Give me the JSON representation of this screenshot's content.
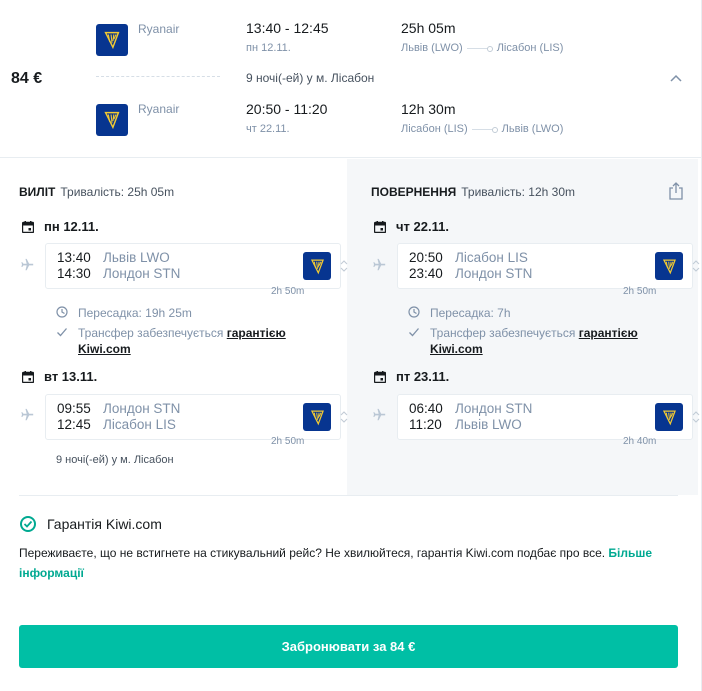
{
  "summary": {
    "price": "84 €",
    "outbound": {
      "carrier": "Ryanair",
      "times": "13:40 - 12:45",
      "date": "пн 12.11.",
      "duration": "25h 05m",
      "from": "Львів (LWO)",
      "to": "Лісабон (LIS)"
    },
    "stay": "9 ночі(-ей) у м. Лісабон",
    "inbound": {
      "carrier": "Ryanair",
      "times": "20:50 - 11:20",
      "date": "чт 22.11.",
      "duration": "12h 30m",
      "from": "Лісабон (LIS)",
      "to": "Львів (LWO)"
    }
  },
  "outbound_detail": {
    "label": "ВИЛІТ",
    "duration": "Тривалість: 25h 05m",
    "day1": "пн 12.11.",
    "seg1": {
      "dep_time": "13:40",
      "dep_place": "Львів LWO",
      "arr_time": "14:30",
      "arr_place": "Лондон STN",
      "duration": "2h 50m"
    },
    "layover": "Пересадка: 19h 25m",
    "transfer_text": "Трансфер забезпечується ",
    "transfer_link1": "гарантією",
    "transfer_link2": "Kiwi.com",
    "day2": "вт 13.11.",
    "seg2": {
      "dep_time": "09:55",
      "dep_place": "Лондон STN",
      "arr_time": "12:45",
      "arr_place": "Лісабон LIS",
      "duration": "2h 50m"
    },
    "nights": "9 ночі(-ей) у м. Лісабон"
  },
  "return_detail": {
    "label": "ПОВЕРНЕННЯ",
    "duration": "Тривалість: 12h 30m",
    "day1": "чт 22.11.",
    "seg1": {
      "dep_time": "20:50",
      "dep_place": "Лісабон LIS",
      "arr_time": "23:40",
      "arr_place": "Лондон STN",
      "duration": "2h 50m"
    },
    "layover": "Пересадка: 7h",
    "transfer_text": "Трансфер забезпечується ",
    "transfer_link1": "гарантією",
    "transfer_link2": "Kiwi.com",
    "day2": "пт 23.11.",
    "seg2": {
      "dep_time": "06:40",
      "dep_place": "Лондон STN",
      "arr_time": "11:20",
      "arr_place": "Львів LWO",
      "duration": "2h 40m"
    }
  },
  "guarantee": {
    "title": "Гарантія Kiwi.com",
    "text": "Переживаєте, що не встигнете на стикувальний рейс? Не хвилюйтеся, гарантія Kiwi.com подбає про все. ",
    "link": "Більше інформації"
  },
  "book_button": "Забронювати за 84 €",
  "colors": {
    "accent": "#00a991",
    "button": "#00bfa5",
    "ryanair_blue": "#073590",
    "ryanair_harp": "#f1c933"
  },
  "icons": [
    "ryanair-logo",
    "chevron-up-icon",
    "share-icon",
    "calendar-icon",
    "plane-icon",
    "clock-icon",
    "check-icon",
    "shield-check-icon",
    "sort-arrows-icon"
  ]
}
